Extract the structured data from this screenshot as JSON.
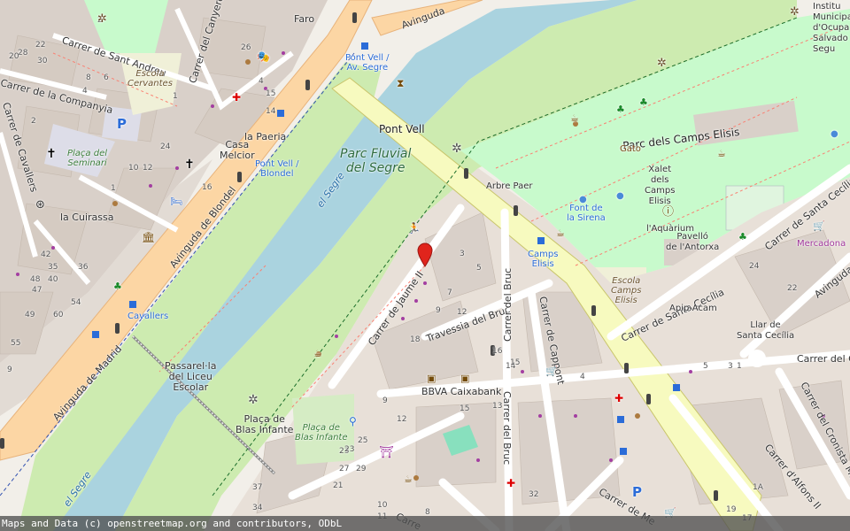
{
  "attribution": "Maps and Data (c) openstreetmap.org and contributors, ODbL",
  "colors": {
    "background": "#f2efe9",
    "building": "#d9d0c9",
    "park": "#c8facc",
    "grass": "#cdebb0",
    "water": "#aad3df",
    "primary_road": "#fcd6a4",
    "secondary_road": "#f7fabf",
    "marker": "#e0241c"
  },
  "labels": {
    "parc_fluvial": "Parc Fluvial\ndel Segre",
    "parc_camps_elisis": "Parc dels Camps Elisis",
    "el_segre_1": "el Segre",
    "el_segre_2": "el Segre",
    "pont_vell": "Pont Vell",
    "pont_vell_av_segre": "Pont Vell /\nAv. Segre",
    "pont_vell_blondel": "Pont Vell /\nBlondel",
    "passarel_la": "Passarel·la\ndel Liceu\nEscolar",
    "placa_blas_infante": "Plaça de\nBlas Infante",
    "placa_blas_infante_green": "Plaça de\nBlas Infante",
    "avinguda_madrid": "Avinguda de Madrid",
    "avinguda_blondel": "Avinguda de Blondel",
    "avinguda_segre": "Avinguda",
    "carrer_sant_andreu": "Carrer de Sant Andreu",
    "carrer_companyia": "Carrer de la Companyia",
    "carrer_cavallers": "Carrer de Cavallers",
    "carrer_canyeret": "Carrer del Canyeret",
    "carrer_jaume": "Carrer de Jaume II",
    "travessia_bruc": "Travessia del Bruc",
    "carrer_bruc": "Carrer del Bruc",
    "carrer_bruc_2": "Carrer del Bruc",
    "carrer_cappont": "Carrer de Cappont",
    "carrer_santa_cecilia": "Carrer de Santa Cecília",
    "carrer_santa_cecilia_2": "Carrer de Santa Cecília",
    "avinguda_pallars": "Avinguda de",
    "carrer_del": "Carrer del C",
    "carrer_cronista": "Carrer del Cronista Muntaner",
    "carrer_alfons": "Carrer d'Alfons II",
    "carrer_de_me": "Carrer de Me",
    "carrer_bottom": "Carre",
    "bbva": "BBVA Caixabank",
    "faro": "Faro",
    "escola_cervantes": "Escola\nCervantes",
    "placa_seminari": "Plaça del\nSeminari",
    "la_cuirassa": "la Cuirassa",
    "casa_melcior": "Casa\nMelcior",
    "la_paeria": "la Paeria",
    "cavallers": "Cavallers",
    "arbre_paer": "Arbre Paer",
    "gato": "Gato",
    "xalet": "Xalet\ndels\nCamps\nElisis",
    "font_sirena": "Font de\nla Sirena",
    "aquarium": "l'Aquàrium",
    "pavello": "Pavelló\nde l'Antorxa",
    "camps_elisis_stop": "Camps\nElisis",
    "escola_camps": "Escola\nCamps\nElisis",
    "apip_acam": "Apip-Acam",
    "llar": "Llar de\nSanta Cecília",
    "mercadona": "Mercadona",
    "institut": "Institu\nMunicipa\nd'Ocupa\nSalvado\nSegu"
  },
  "house_numbers": [
    "22",
    "30",
    "28",
    "20",
    "8",
    "6",
    "4",
    "2",
    "2",
    "1",
    "1",
    "24",
    "10",
    "12",
    "16",
    "15",
    "14",
    "4",
    "37",
    "34",
    "25",
    "23",
    "27",
    "29",
    "8",
    "32",
    "18",
    "16",
    "14",
    "13",
    "15",
    "9",
    "7",
    "5",
    "3",
    "12",
    "24",
    "22",
    "5",
    "3",
    "1",
    "1A",
    "4",
    "19",
    "17",
    "23",
    "21",
    "9",
    "10",
    "11",
    "12",
    "26",
    "15",
    "49",
    "60",
    "55",
    "54",
    "47",
    "42",
    "35",
    "36",
    "9",
    "40",
    "48"
  ]
}
